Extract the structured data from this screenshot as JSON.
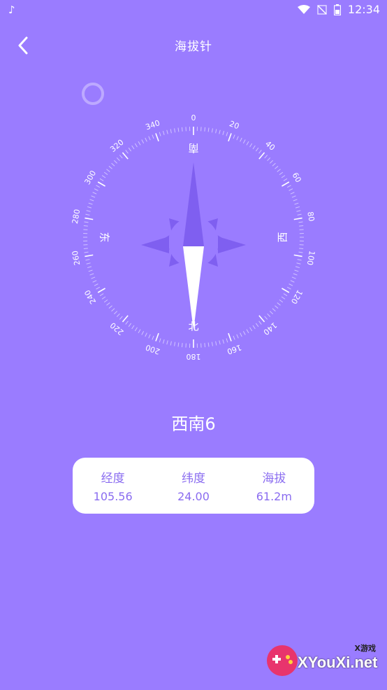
{
  "status_bar": {
    "time": "12:34",
    "icons": [
      "tiktok-icon",
      "wifi-icon",
      "no-signal-icon",
      "battery-icon"
    ]
  },
  "header": {
    "title": "海拔针",
    "back_icon": "chevron-left-icon"
  },
  "compass": {
    "tick_labels": [
      "0",
      "20",
      "40",
      "60",
      "80",
      "100",
      "120",
      "140",
      "160",
      "180",
      "200",
      "220",
      "240",
      "260",
      "280",
      "300",
      "320",
      "340"
    ],
    "cardinal_labels": {
      "top": "南",
      "right": "西",
      "bottom": "北",
      "left": "东"
    }
  },
  "direction": {
    "text": "西南6"
  },
  "info": {
    "longitude_label": "经度",
    "longitude_value": "105.56",
    "latitude_label": "纬度",
    "latitude_value": "24.00",
    "altitude_label": "海拔",
    "altitude_value": "61.2m"
  },
  "watermark": {
    "main": "XYouXi.net",
    "small": "X游戏"
  },
  "colors": {
    "background": "#9a7cff",
    "star_dark": "#7f5ff0",
    "card_text": "#8a6cf0"
  }
}
